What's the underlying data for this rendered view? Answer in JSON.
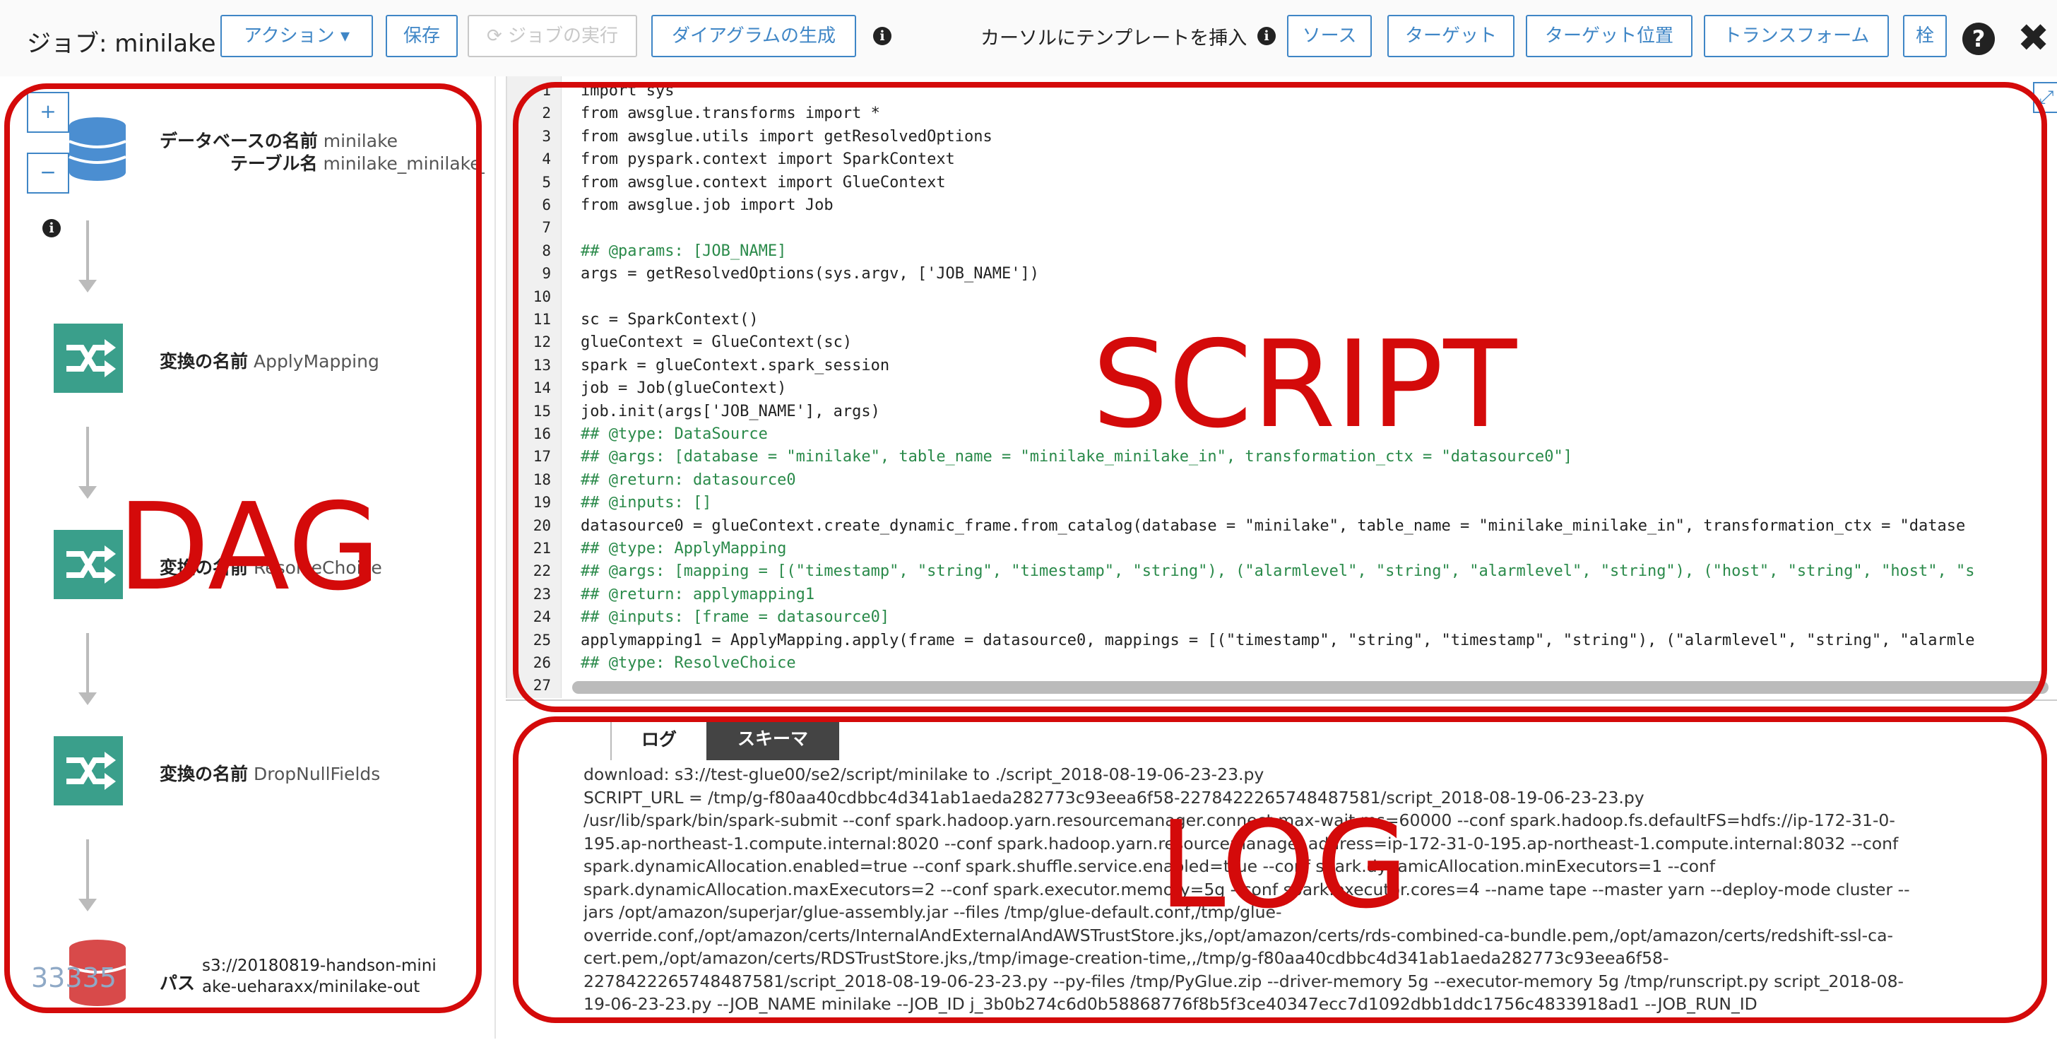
{
  "toolbar": {
    "job_label": "ジョブ: minilake",
    "action_button": "アクション ▾",
    "save_button": "保存",
    "run_job_button": "ジョブの実行",
    "generate_diagram_button": "ダイアグラムの生成",
    "insert_template_label": "カーソルにテンプレートを挿入",
    "source_button": "ソース",
    "target_button": "ターゲット",
    "target_location_button": "ターゲット位置",
    "transform_button": "トランスフォーム",
    "extra_button": "栓"
  },
  "dag": {
    "zoom_in": "+",
    "zoom_out": "−",
    "source_node": {
      "db_label": "データベースの名前",
      "db_value": "minilake",
      "table_label": "テーブル名",
      "table_value": "minilake_minilake_in"
    },
    "transforms": [
      {
        "label": "変換の名前",
        "value": "ApplyMapping"
      },
      {
        "label": "変換の名前",
        "value": "ResolveChoice"
      },
      {
        "label": "変換の名前",
        "value": "DropNullFields"
      }
    ],
    "target_node": {
      "path_label": "パス",
      "path_line1": "s3://20180819-handson-mini",
      "path_line2": "ake-ueharaxx/minilake-out",
      "icon_text": "33335"
    }
  },
  "editor": {
    "lines": [
      "import sys",
      "from awsglue.transforms import *",
      "from awsglue.utils import getResolvedOptions",
      "from pyspark.context import SparkContext",
      "from awsglue.context import GlueContext",
      "from awsglue.job import Job",
      "",
      "## @params: [JOB_NAME]",
      "args = getResolvedOptions(sys.argv, ['JOB_NAME'])",
      "",
      "sc = SparkContext()",
      "glueContext = GlueContext(sc)",
      "spark = glueContext.spark_session",
      "job = Job(glueContext)",
      "job.init(args['JOB_NAME'], args)",
      "## @type: DataSource",
      "## @args: [database = \"minilake\", table_name = \"minilake_minilake_in\", transformation_ctx = \"datasource0\"]",
      "## @return: datasource0",
      "## @inputs: []",
      "datasource0 = glueContext.create_dynamic_frame.from_catalog(database = \"minilake\", table_name = \"minilake_minilake_in\", transformation_ctx = \"datase",
      "## @type: ApplyMapping",
      "## @args: [mapping = [(\"timestamp\", \"string\", \"timestamp\", \"string\"), (\"alarmlevel\", \"string\", \"alarmlevel\", \"string\"), (\"host\", \"string\", \"host\", \"s",
      "## @return: applymapping1",
      "## @inputs: [frame = datasource0]",
      "applymapping1 = ApplyMapping.apply(frame = datasource0, mappings = [(\"timestamp\", \"string\", \"timestamp\", \"string\"), (\"alarmlevel\", \"string\", \"alarmle",
      "## @type: ResolveChoice",
      ""
    ]
  },
  "log": {
    "tab_log": "ログ",
    "tab_schema": "スキーマ",
    "lines": [
      "download: s3://test-glue00/se2/script/minilake to ./script_2018-08-19-06-23-23.py",
      "SCRIPT_URL = /tmp/g-f80aa40cdbbc4d341ab1aeda282773c93eea6f58-2278422265748487581/script_2018-08-19-06-23-23.py",
      "/usr/lib/spark/bin/spark-submit --conf spark.hadoop.yarn.resourcemanager.connect.max-wait.ms=60000 --conf spark.hadoop.fs.defaultFS=hdfs://ip-172-31-0-",
      "195.ap-northeast-1.compute.internal:8020 --conf spark.hadoop.yarn.resourcemanager.address=ip-172-31-0-195.ap-northeast-1.compute.internal:8032 --conf",
      "spark.dynamicAllocation.enabled=true --conf spark.shuffle.service.enabled=true --conf spark.dynamicAllocation.minExecutors=1 --conf",
      "spark.dynamicAllocation.maxExecutors=2 --conf spark.executor.memory=5g --conf spark.executor.cores=4 --name tape --master yarn --deploy-mode cluster --",
      "jars /opt/amazon/superjar/glue-assembly.jar --files /tmp/glue-default.conf,/tmp/glue-",
      "override.conf,/opt/amazon/certs/InternalAndExternalAndAWSTrustStore.jks,/opt/amazon/certs/rds-combined-ca-bundle.pem,/opt/amazon/certs/redshift-ssl-ca-",
      "cert.pem,/opt/amazon/certs/RDSTrustStore.jks,/tmp/image-creation-time,,/tmp/g-f80aa40cdbbc4d341ab1aeda282773c93eea6f58-",
      "2278422265748487581/script_2018-08-19-06-23-23.py --py-files /tmp/PyGlue.zip --driver-memory 5g --executor-memory 5g /tmp/runscript.py script_2018-08-",
      "19-06-23-23.py --JOB_NAME minilake --JOB_ID j_3b0b274c6d0b58868776f8b5f3ce40347ecc7d1092dbb1ddc1756c4833918ad1 --JOB_RUN_ID"
    ]
  },
  "annotations": {
    "dag": "DAG",
    "script": "SCRIPT",
    "log": "LOG",
    "color": "#d40a0a"
  }
}
